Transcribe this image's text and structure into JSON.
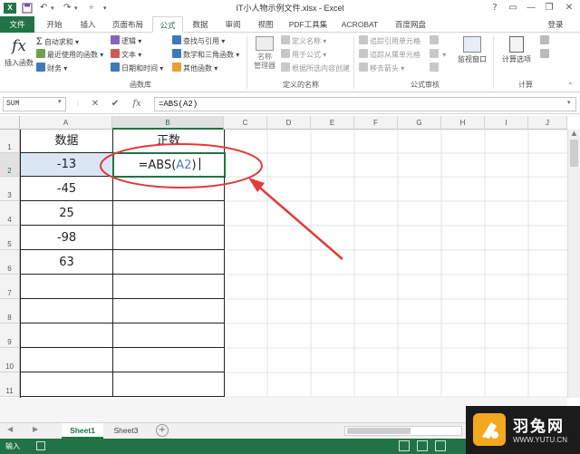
{
  "window": {
    "title": "IT小人物示例文件.xlsx - Excel",
    "qa_icons": [
      "save-icon",
      "undo-icon",
      "redo-icon"
    ],
    "controls": [
      "?",
      "▭",
      "—",
      "❐",
      "✕"
    ]
  },
  "ribbon_tabs": [
    {
      "label": "文件"
    },
    {
      "label": "开始"
    },
    {
      "label": "插入"
    },
    {
      "label": "页面布局"
    },
    {
      "label": "公式",
      "active": true
    },
    {
      "label": "数据"
    },
    {
      "label": "审阅"
    },
    {
      "label": "视图"
    },
    {
      "label": "PDF工具集"
    },
    {
      "label": "ACROBAT"
    },
    {
      "label": "百度网盘"
    }
  ],
  "login": "登录",
  "ribbon": {
    "insert_function": "插入函数",
    "library": {
      "col1": [
        "自动求和",
        "最近使用的函数",
        "财务"
      ],
      "col2": [
        "逻辑",
        "文本",
        "日期和时间"
      ],
      "col3": [
        "查找与引用",
        "数学和三角函数",
        "其他函数"
      ],
      "group": "函数库"
    },
    "names": {
      "manager": "名称\n管理器",
      "items": [
        "定义名称",
        "用于公式",
        "根据所选内容创建"
      ],
      "group": "定义的名称"
    },
    "audit": {
      "col1": [
        "追踪引用单元格",
        "追踪从属单元格",
        "移去箭头"
      ],
      "watch": "监视窗口",
      "group": "公式审核"
    },
    "calc": {
      "options": "计算选项",
      "group": "计算"
    }
  },
  "formula_bar": {
    "name_box": "SUM",
    "cancel": "✕",
    "enter": "✔",
    "fx": "fx",
    "formula": "=ABS(A2)"
  },
  "columns": [
    "A",
    "B",
    "C",
    "D",
    "E",
    "F",
    "G",
    "H",
    "I",
    "J"
  ],
  "rows": [
    "1",
    "2",
    "3",
    "4",
    "5",
    "6",
    "7",
    "8",
    "9",
    "10",
    "11"
  ],
  "cells": {
    "A1": "数据",
    "B1": "正数",
    "A2": "-13",
    "A3": "-45",
    "A4": "25",
    "A5": "-98",
    "A6": "63",
    "B2_prefix": "=ABS(",
    "B2_ref": "A2",
    "B2_suffix": ")"
  },
  "sheets": [
    {
      "label": "Sheet1",
      "active": true
    },
    {
      "label": "Sheet3",
      "active": false
    }
  ],
  "status": "输入",
  "watermark": {
    "brand": "羽兔网",
    "url": "WWW.YUTU.CN"
  },
  "colors": {
    "excel_green": "#217346",
    "annotation_red": "#e03a3a",
    "ref_blue": "#4a7fbf"
  }
}
